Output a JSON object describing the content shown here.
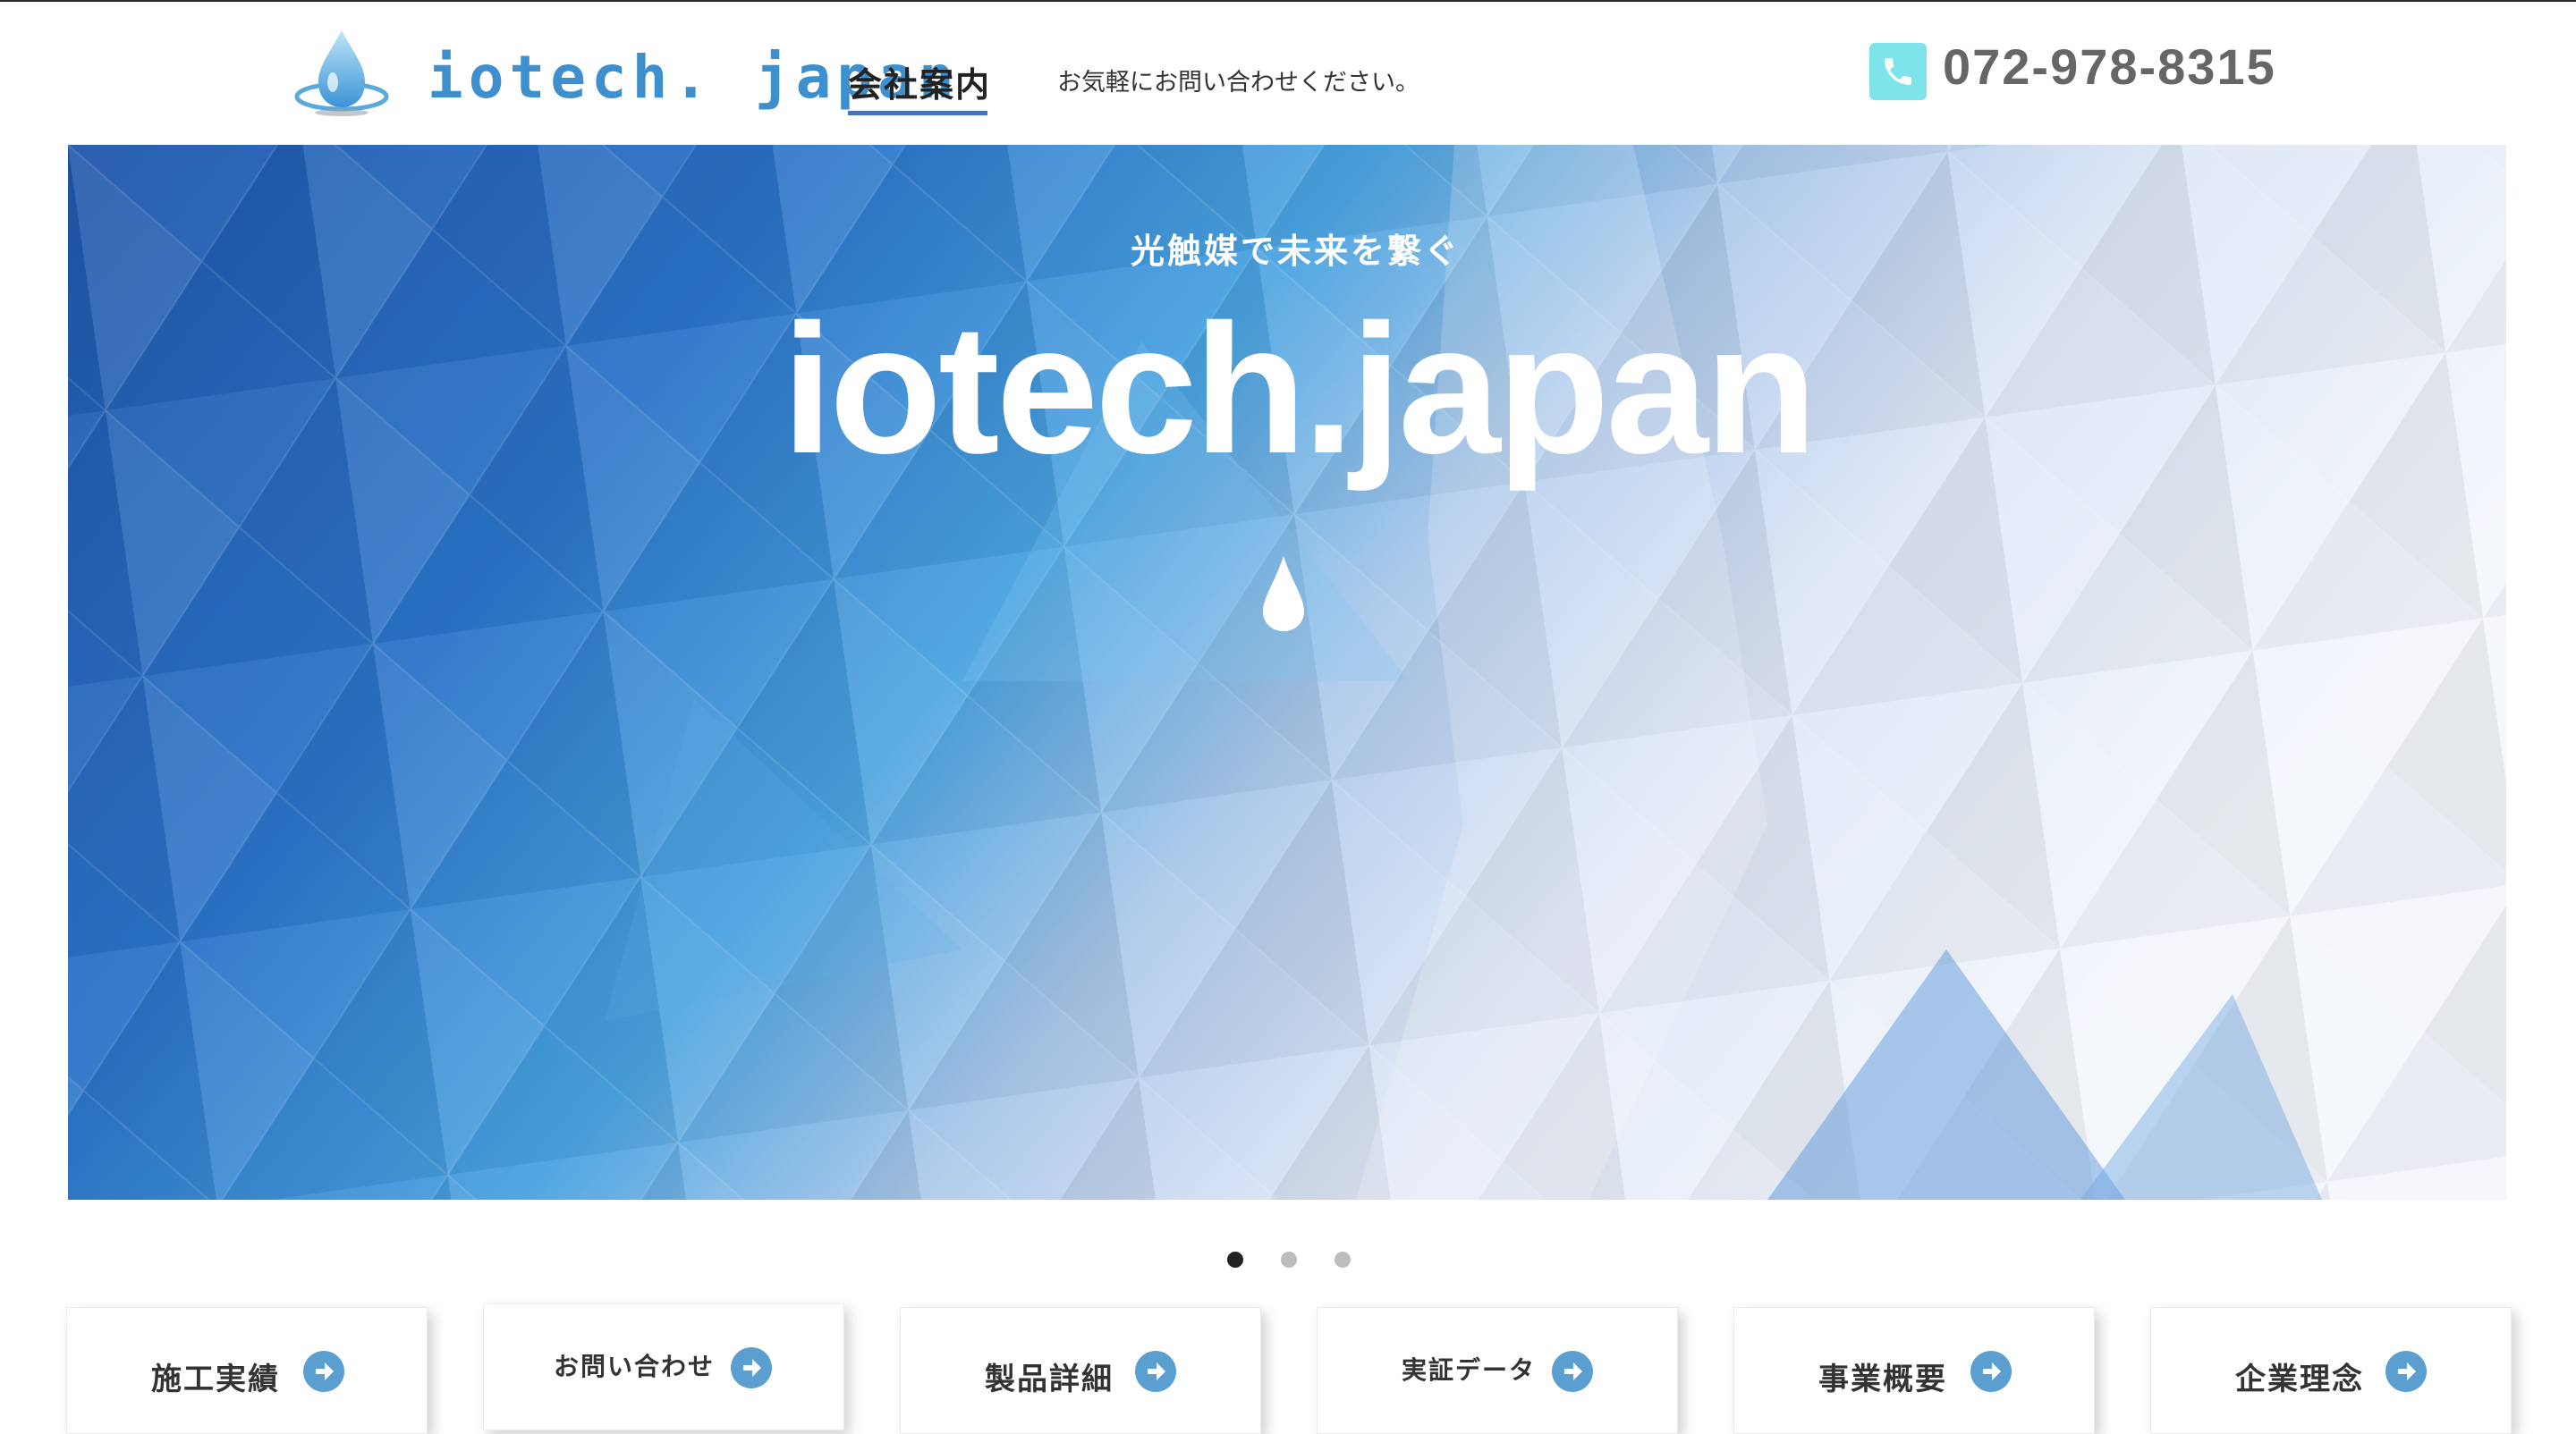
{
  "header": {
    "logo_text": "iotech. japan",
    "nav_company": "会社案内",
    "nav_contact": "お気軽にお問い合わせください。",
    "phone_number": "072-978-8315"
  },
  "hero": {
    "tagline": "光触媒で未来を繋ぐ",
    "title": "iotech.japan"
  },
  "carousel": {
    "slides": 3,
    "active_index": 0
  },
  "cards": [
    {
      "label": "施工実績"
    },
    {
      "label": "お問い合わせ"
    },
    {
      "label": "製品詳細"
    },
    {
      "label": "実証データ"
    },
    {
      "label": "事業概要"
    },
    {
      "label": "企業理念"
    }
  ],
  "colors": {
    "logo_blue": "#3d8fcd",
    "nav_underline": "#4574b8",
    "phone_icon_bg": "#7ee3ea",
    "card_arrow": "#5a9fd0",
    "hero_dark_blue": "#1f5fb3",
    "hero_light": "#eef2fa"
  },
  "icons": {
    "logo": "water-drop-icon",
    "phone": "phone-icon",
    "hero": "water-drop-icon",
    "card": "arrow-right-circle-icon"
  }
}
